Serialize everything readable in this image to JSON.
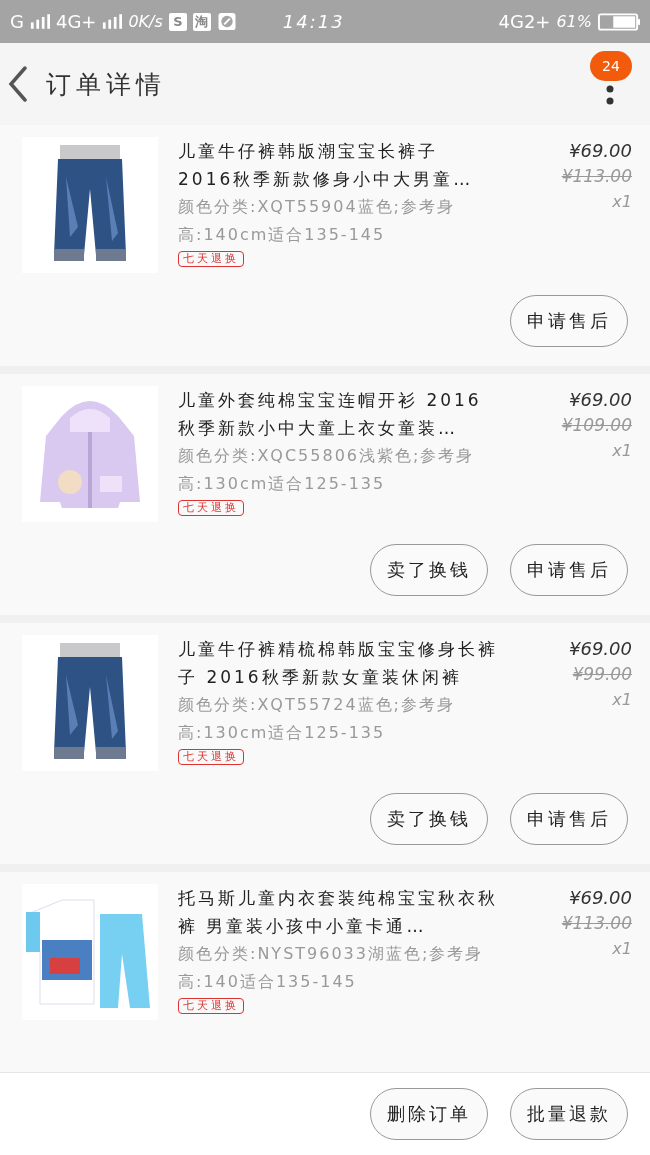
{
  "status_bar": {
    "signal_1": "G",
    "signal_2": "4G+",
    "speed": "0K/s",
    "notifications": [
      "S",
      "淘"
    ],
    "time": "14:13",
    "network": "4G2+",
    "battery": "61%"
  },
  "header": {
    "title": "订单详情",
    "badge": "24"
  },
  "items": [
    {
      "title": "儿童牛仔裤韩版潮宝宝长裤子 2016秋季新款修身小中大男童…",
      "spec": "颜色分类:XQT55904蓝色;参考身高:140cm适合135-145",
      "price": "¥69.00",
      "original_price": "¥113.00",
      "quantity": "x1",
      "tag": "七天退换",
      "buttons": [
        "申请售后"
      ]
    },
    {
      "title": "儿童外套纯棉宝宝连帽开衫 2016 秋季新款小中大童上衣女童装…",
      "spec": "颜色分类:XQC55806浅紫色;参考身高:130cm适合125-135",
      "price": "¥69.00",
      "original_price": "¥109.00",
      "quantity": "x1",
      "tag": "七天退换",
      "buttons": [
        "卖了换钱",
        "申请售后"
      ]
    },
    {
      "title": "儿童牛仔裤精梳棉韩版宝宝修身长裤子 2016秋季新款女童装休闲裤",
      "spec": "颜色分类:XQT55724蓝色;参考身高:130cm适合125-135",
      "price": "¥69.00",
      "original_price": "¥99.00",
      "quantity": "x1",
      "tag": "七天退换",
      "buttons": [
        "卖了换钱",
        "申请售后"
      ]
    },
    {
      "title": "托马斯儿童内衣套装纯棉宝宝秋衣秋裤 男童装小孩中小童卡通…",
      "spec": "颜色分类:NYST96033湖蓝色;参考身高:140适合135-145",
      "price": "¥69.00",
      "original_price": "¥113.00",
      "quantity": "x1",
      "tag": "七天退换"
    }
  ],
  "footer_buttons": [
    "删除订单",
    "批量退款"
  ]
}
